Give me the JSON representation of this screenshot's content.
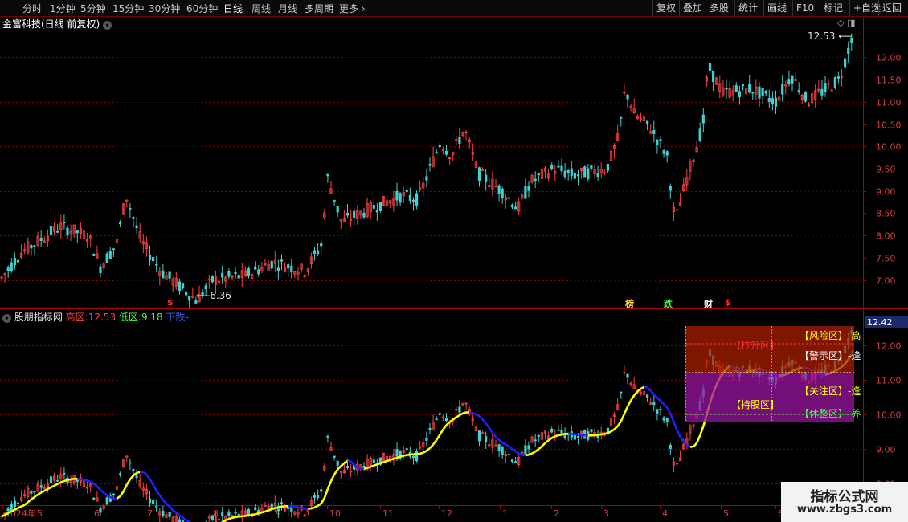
{
  "toolbar": {
    "periods": [
      "分时",
      "1分钟",
      "5分钟",
      "15分钟",
      "30分钟",
      "60分钟",
      "日线",
      "周线",
      "月线",
      "多周期",
      "更多"
    ],
    "active_period": "日线",
    "right_buttons": [
      "复权",
      "叠加",
      "多股",
      "统计",
      "画线",
      "F10",
      "标记",
      "+自选",
      "返回"
    ]
  },
  "main_panel": {
    "title": "金富科技(日线 前复权)",
    "high_marker": "12.53",
    "low_marker": "6.36",
    "y_ticks": [
      "12.00",
      "11.50",
      "11.00",
      "10.50",
      "10.00",
      "9.50",
      "9.00",
      "8.50",
      "8.00",
      "7.50",
      "7.00"
    ],
    "event_badges": [
      {
        "text": "$",
        "color": "#ff3030"
      },
      {
        "text": "榜",
        "color": "#ffd040"
      },
      {
        "text": "跌",
        "color": "#40ff40"
      },
      {
        "text": "财",
        "color": "#ffffff"
      },
      {
        "text": "$",
        "color": "#ff3030"
      }
    ]
  },
  "indicator_panel": {
    "name": "股朋指标网",
    "high_label": "高区:",
    "high_value": "12.53",
    "low_label": "低区:",
    "low_value": "9.18",
    "trend": "下跌",
    "current_price_tag": "12.42",
    "y_ticks": [
      "12.00",
      "11.00",
      "10.00",
      "9.00",
      "8.00"
    ],
    "zones": [
      {
        "label": "【风险区】",
        "suffix": "-高",
        "color": "#ffff00"
      },
      {
        "label": "【拉升区】",
        "suffix": "",
        "color": "#ff3030"
      },
      {
        "label": "【警示区】",
        "suffix": "-逢",
        "color": "#ffffff"
      },
      {
        "label": "【关注区】",
        "suffix": "-逢",
        "color": "#ffff00"
      },
      {
        "label": "【持股区】",
        "suffix": "",
        "color": "#ffff00"
      },
      {
        "label": "【休整区】",
        "suffix": "-养",
        "color": "#40ff40"
      }
    ]
  },
  "x_axis": {
    "labels": [
      "2024年",
      "5",
      "6",
      "7",
      "8",
      "9",
      "10",
      "11",
      "12",
      "1",
      "2",
      "3",
      "4",
      "5",
      "6"
    ]
  },
  "watermark": {
    "title": "指标公式网",
    "url": "www.zbgs3.com"
  },
  "colors": {
    "up": "#ff4040",
    "down": "#40d0d0",
    "ma_up": "#ffff00",
    "ma_down": "#2020ff",
    "grid": "#7a0000"
  },
  "chart_data": {
    "type": "candlestick",
    "ticker_title": "金富科技(日线 前复权)",
    "period_high": 12.53,
    "period_low": 6.36,
    "indicator": {
      "name": "股朋指标网",
      "high_zone": 12.53,
      "low_zone": 9.18,
      "trend": "下跌",
      "last": 12.42
    },
    "x_labels": [
      "2024年",
      "5",
      "6",
      "7",
      "8",
      "9",
      "10",
      "11",
      "12",
      "1",
      "2",
      "3",
      "4",
      "5",
      "6"
    ],
    "y_range_main": [
      6.4,
      12.6
    ]
  }
}
